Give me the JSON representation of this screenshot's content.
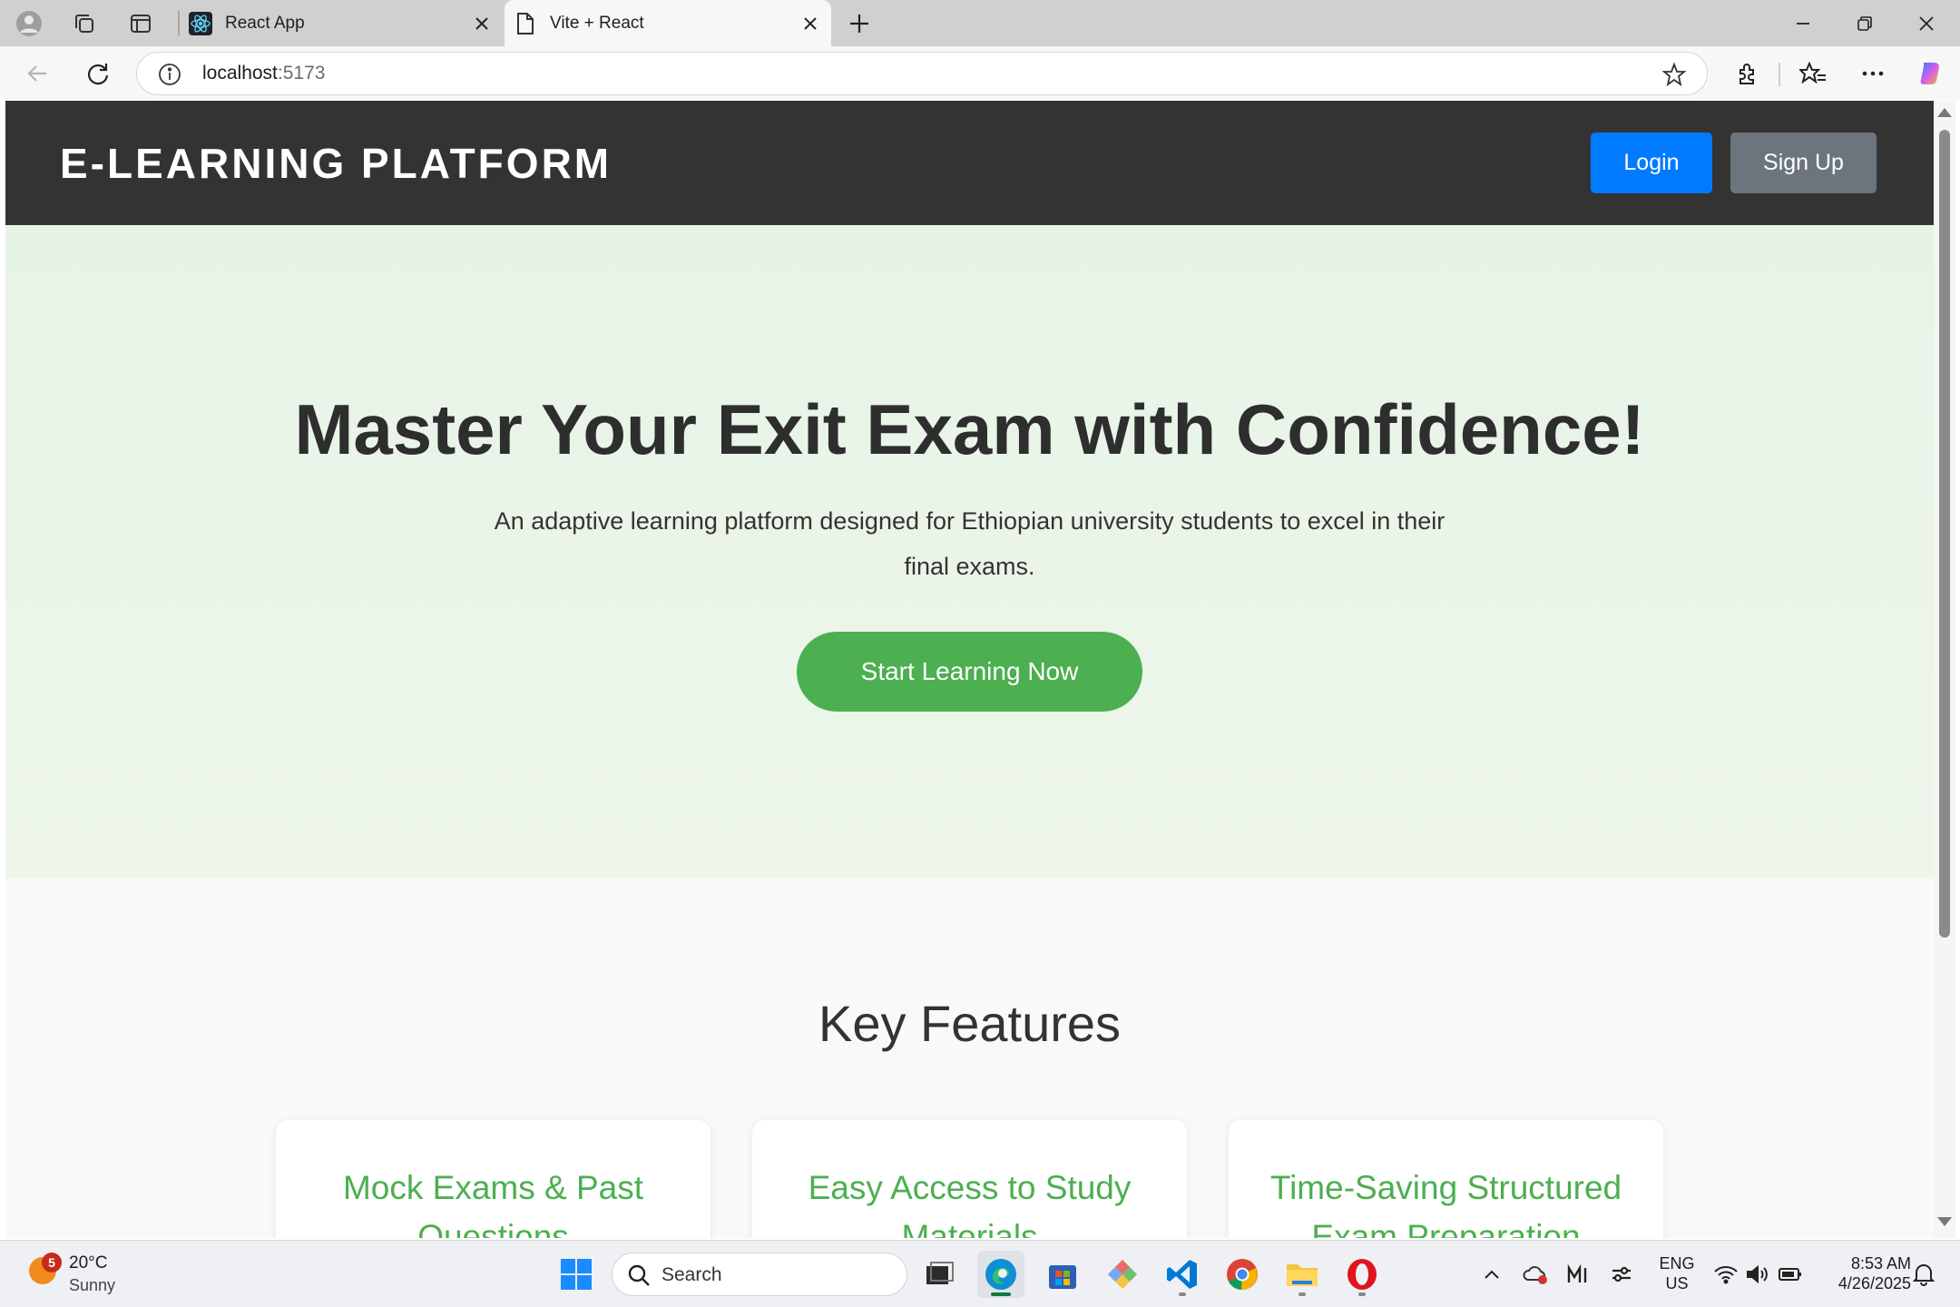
{
  "browser": {
    "tabs": [
      {
        "label": "React App",
        "active": false
      },
      {
        "label": "Vite + React",
        "active": true
      }
    ],
    "url_host": "localhost",
    "url_port": ":5173"
  },
  "site": {
    "brand": "E-LEARNING PLATFORM",
    "nav": {
      "login": "Login",
      "signup": "Sign Up"
    },
    "hero": {
      "title": "Master Your Exit Exam with Confidence!",
      "subtitle": "An adaptive learning platform designed for Ethiopian university students to excel in their final exams.",
      "cta": "Start Learning Now"
    },
    "features": {
      "title": "Key Features",
      "cards": [
        {
          "title": "Mock Exams & Past Questions"
        },
        {
          "title": "Easy Access to Study Materials"
        },
        {
          "title": "Time-Saving Structured Exam Preparation"
        }
      ]
    }
  },
  "taskbar": {
    "weather": {
      "temp": "20°C",
      "condition": "Sunny",
      "badge": "5"
    },
    "search_placeholder": "Search",
    "lang_line1": "ENG",
    "lang_line2": "US",
    "time": "8:53 AM",
    "date": "4/26/2025"
  },
  "colors": {
    "header_bg": "#333333",
    "login_btn": "#007bff",
    "signup_btn": "#6c757d",
    "accent_green": "#4caf50",
    "hero_bg": "#e6f4e6"
  },
  "icons": [
    "profile-icon",
    "workspaces-icon",
    "tab-actions-icon",
    "react-icon",
    "page-icon",
    "close-icon",
    "new-tab-icon",
    "minimize-icon",
    "restore-icon",
    "back-icon",
    "refresh-icon",
    "info-icon",
    "star-icon",
    "extensions-icon",
    "favorites-icon",
    "more-icon",
    "copilot-icon",
    "windows-start-icon",
    "search-icon",
    "task-view-icon",
    "edge-icon",
    "store-icon",
    "app-icon",
    "vscode-icon",
    "chrome-icon",
    "file-explorer-icon",
    "opera-icon",
    "chevron-up-icon",
    "wifi-icon",
    "volume-icon",
    "battery-icon",
    "notification-icon"
  ]
}
